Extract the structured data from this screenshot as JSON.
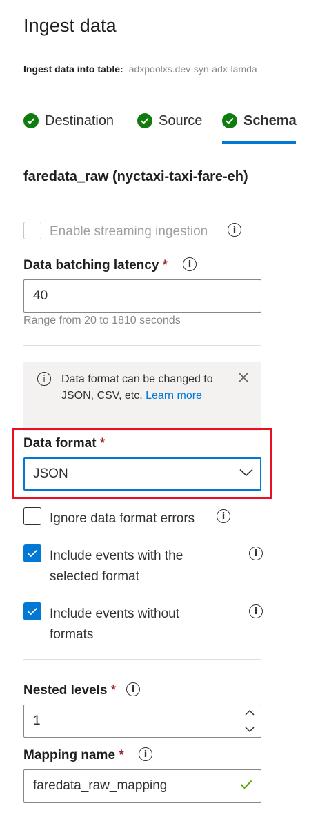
{
  "page": {
    "title": "Ingest data"
  },
  "table": {
    "label": "Ingest data into table:",
    "value": "adxpoolxs.dev-syn-adx-lamda"
  },
  "tabs": [
    {
      "label": "Destination"
    },
    {
      "label": "Source"
    },
    {
      "label": "Schema"
    }
  ],
  "section": {
    "title": "faredata_raw (nyctaxi-taxi-fare-eh)"
  },
  "streaming": {
    "label": "Enable streaming ingestion",
    "checked": false,
    "disabled": true
  },
  "batching": {
    "label": "Data batching latency",
    "required": "*",
    "value": "40",
    "hint": "Range from 20 to 1810 seconds"
  },
  "message": {
    "text": "Data format can be changed to JSON, CSV, etc.",
    "link": "Learn more"
  },
  "data_format": {
    "label": "Data format",
    "required": "*",
    "selected": "JSON"
  },
  "options": {
    "ignore_errors": {
      "label": "Ignore data format errors",
      "checked": false
    },
    "include_selected": {
      "label": "Include events with the selected format",
      "checked": true
    },
    "include_without": {
      "label": "Include events without formats",
      "checked": true
    }
  },
  "nested": {
    "label": "Nested levels",
    "required": "*",
    "value": "1"
  },
  "mapping": {
    "label": "Mapping name",
    "required": "*",
    "value": "faredata_raw_mapping"
  },
  "colors": {
    "accent": "#0078d4",
    "success": "#107c10",
    "required": "#a4262c",
    "highlight": "#e81123"
  }
}
